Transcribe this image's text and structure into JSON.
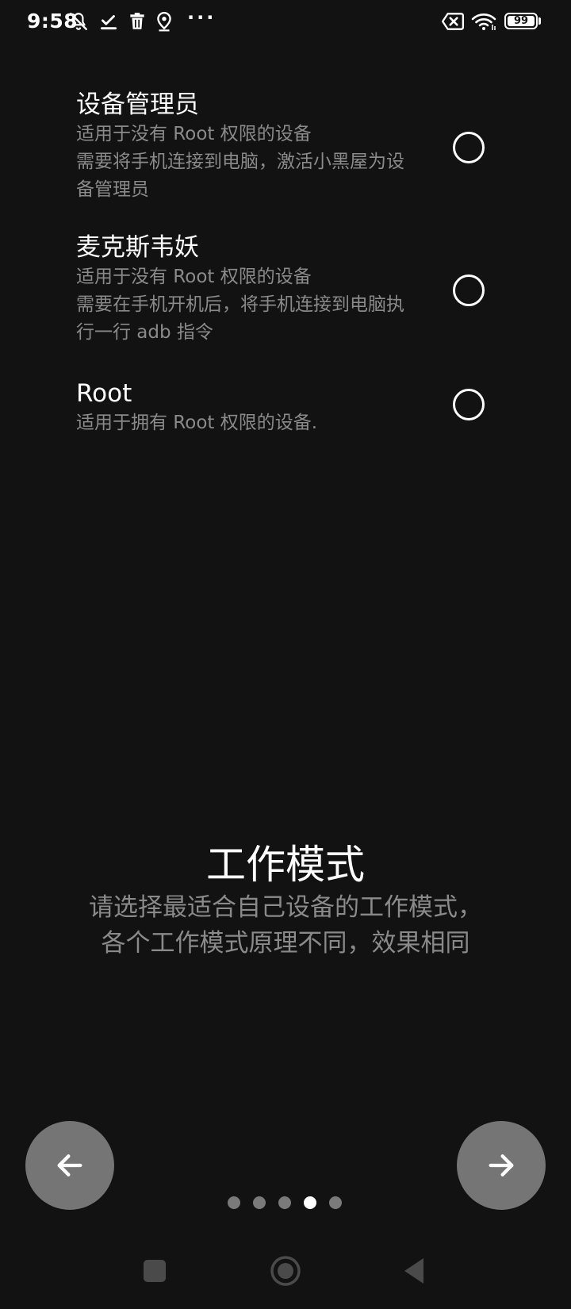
{
  "status_bar": {
    "time": "9:58",
    "icons": [
      "notifications-off-icon",
      "check-icon",
      "trash-icon",
      "location-icon",
      "more-dots-icon",
      "no-sim-icon",
      "wifi-icon",
      "battery-icon"
    ],
    "more": "···",
    "battery_level": "99",
    "battery_fraction": 0.99
  },
  "options": [
    {
      "title": "设备管理员",
      "desc_lines": [
        "适用于没有 Root 权限的设备",
        "需要将手机连接到电脑，激活小黑屋为设",
        "备管理员"
      ],
      "selected": false
    },
    {
      "title": "麦克斯韦妖",
      "desc_lines": [
        "适用于没有 Root 权限的设备",
        "需要在手机开机后，将手机连接到电脑执",
        "行一行 adb 指令"
      ],
      "selected": false
    },
    {
      "title": "Root",
      "desc_lines": [
        "适用于拥有 Root 权限的设备."
      ],
      "selected": false
    }
  ],
  "page": {
    "title": "工作模式",
    "subtitle_lines": [
      "请选择最适合自己设备的工作模式，",
      "各个工作模式原理不同，效果相同"
    ]
  },
  "navigation": {
    "back_icon": "arrow-left-icon",
    "next_icon": "arrow-right-icon",
    "page_count": 5,
    "current_page": 4
  },
  "system_nav": {
    "icons": [
      "recents-square-icon",
      "home-circle-icon",
      "back-triangle-icon"
    ]
  },
  "colors": {
    "background": "#121212",
    "primary_text": "#ffffff",
    "secondary_text": "#8a8a8a",
    "button_fill": "#757575"
  }
}
